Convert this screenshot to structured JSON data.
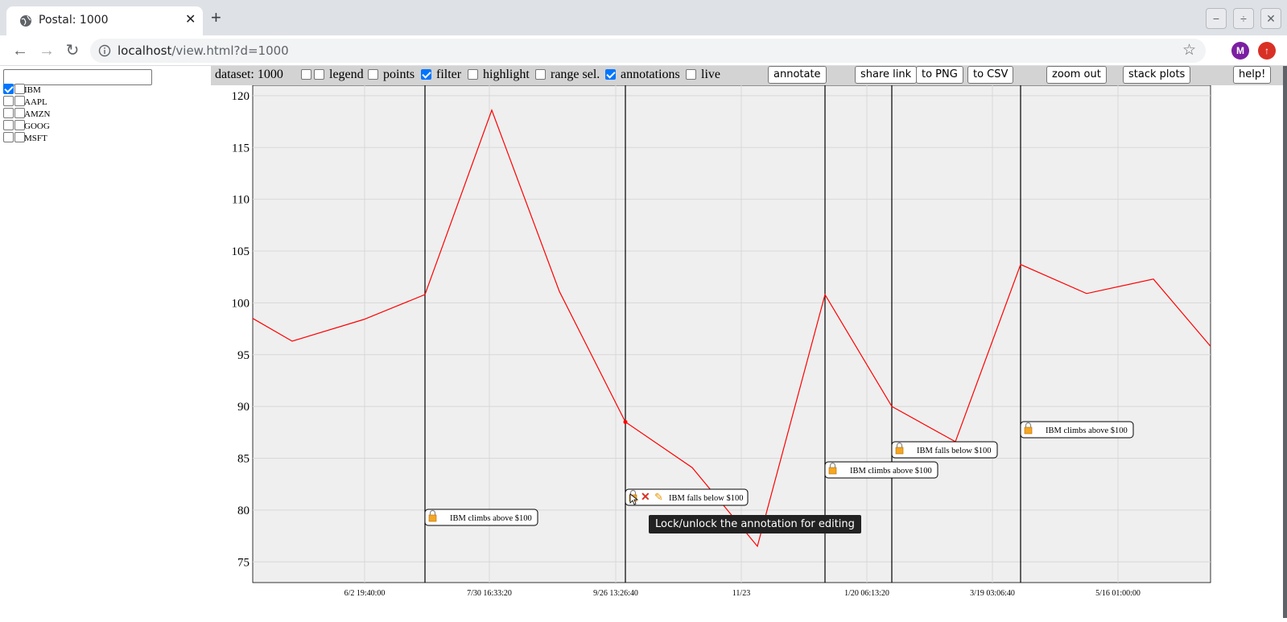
{
  "browser": {
    "tab_title": "Postal: 1000",
    "url_host": "localhost",
    "url_path": "/view.html?d=1000",
    "avatar_letter": "M"
  },
  "sidebar": {
    "search_value": "",
    "tickers": [
      {
        "label": "IBM",
        "checked": true
      },
      {
        "label": "AAPL",
        "checked": false
      },
      {
        "label": "AMZN",
        "checked": false
      },
      {
        "label": "GOOG",
        "checked": false
      },
      {
        "label": "MSFT",
        "checked": false
      }
    ]
  },
  "controls": {
    "dataset_label": "dataset: 1000",
    "legend": "legend",
    "points": "points",
    "filter": "filter",
    "highlight": "highlight",
    "range_sel": "range sel.",
    "annotations": "annotations",
    "live": "live",
    "annotate_btn": "annotate",
    "share_btn": "share link",
    "png_btn": "to PNG",
    "csv_btn": "to CSV",
    "zoomout_btn": "zoom out",
    "stack_btn": "stack plots",
    "help_btn": "help!"
  },
  "tooltip": "Lock/unlock the annotation for editing",
  "colors": {
    "series": "#ff0000",
    "plot_bg": "#efefef",
    "checkbox": "#0075ff"
  },
  "chart_data": {
    "type": "line",
    "ylim": [
      73,
      121
    ],
    "yticks": [
      "75",
      "80",
      "85",
      "90",
      "95",
      "100",
      "105",
      "110",
      "115",
      "120"
    ],
    "xticks": [
      "6/2 19:40:00",
      "7/30 16:33:20",
      "9/26 13:26:40",
      "11/23",
      "1/20 06:13:20",
      "3/19 03:06:40",
      "5/16 01:00:00"
    ],
    "series": [
      {
        "values": [
          98.5,
          96.3,
          98.4,
          100.8,
          118.6,
          101.1,
          88.5,
          84.1,
          76.5,
          100.8,
          90.0,
          86.6,
          103.7,
          100.9,
          102.3,
          95.8
        ]
      }
    ],
    "annotations": [
      {
        "label": "IBM climbs above $100",
        "point_index": 3
      },
      {
        "label": "IBM falls below $100",
        "point_index": 6
      },
      {
        "label": "IBM climbs above $100",
        "point_index": 9
      },
      {
        "label": "IBM falls below $100",
        "point_index": 10
      },
      {
        "label": "IBM climbs above $100",
        "point_index": 12
      }
    ]
  }
}
